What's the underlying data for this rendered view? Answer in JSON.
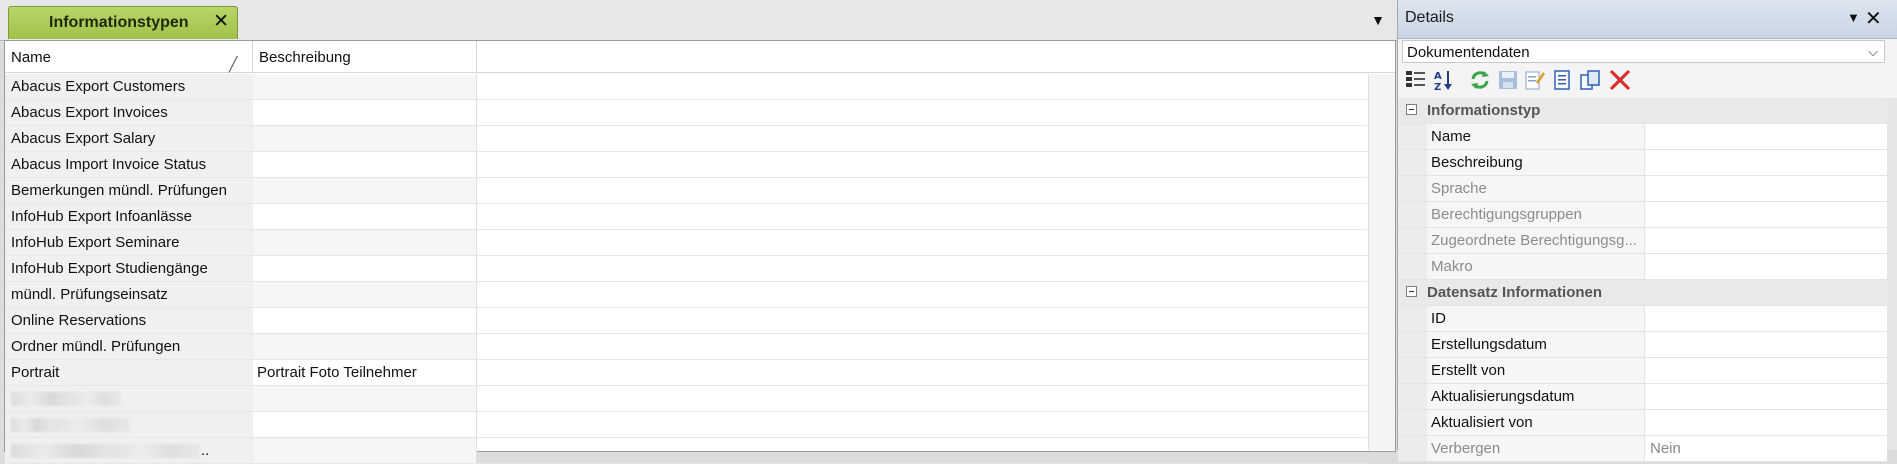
{
  "document": {
    "tab_label": "Informationstypen",
    "tab_close": "✕",
    "tab_dropdown": "▼"
  },
  "grid": {
    "columns": [
      "Name",
      "Beschreibung"
    ],
    "rows": [
      {
        "name": "Abacus Export Customers",
        "desc": ""
      },
      {
        "name": "Abacus Export Invoices",
        "desc": ""
      },
      {
        "name": "Abacus Export Salary",
        "desc": ""
      },
      {
        "name": "Abacus Import Invoice Status",
        "desc": ""
      },
      {
        "name": "Bemerkungen mündl. Prüfungen",
        "desc": ""
      },
      {
        "name": "InfoHub Export Infoanlässe",
        "desc": ""
      },
      {
        "name": "InfoHub Export Seminare",
        "desc": ""
      },
      {
        "name": "InfoHub Export Studiengänge",
        "desc": ""
      },
      {
        "name": "mündl. Prüfungseinsatz",
        "desc": ""
      },
      {
        "name": "Online Reservations",
        "desc": ""
      },
      {
        "name": "Ordner mündl. Prüfungen",
        "desc": ""
      },
      {
        "name": "Portrait",
        "desc": "Portrait Foto Teilnehmer"
      },
      {
        "name": "",
        "desc": ""
      },
      {
        "name": "",
        "desc": ""
      },
      {
        "name": "..",
        "desc": ""
      }
    ]
  },
  "details": {
    "title": "Details",
    "menu_glyph": "▼",
    "close_glyph": "✕",
    "selector_value": "Dokumentendaten",
    "selector_arrow": "⌵",
    "toolbar_icons": [
      "categorized-icon",
      "sort-az-icon",
      "refresh-icon",
      "save-icon",
      "edit-icon",
      "document-icon",
      "copy-icon",
      "delete-icon"
    ],
    "categories": [
      {
        "name": "Informationstyp",
        "props": [
          {
            "name": "Name",
            "value": "",
            "readonly": false
          },
          {
            "name": "Beschreibung",
            "value": "",
            "readonly": false
          },
          {
            "name": "Sprache",
            "value": "",
            "readonly": true
          },
          {
            "name": "Berechtigungsgruppen",
            "value": "",
            "readonly": true
          },
          {
            "name": "Zugeordnete Berechtigungsg...",
            "value": "",
            "readonly": true
          },
          {
            "name": "Makro",
            "value": "",
            "readonly": true
          }
        ]
      },
      {
        "name": "Datensatz Informationen",
        "props": [
          {
            "name": "ID",
            "value": "",
            "readonly": false
          },
          {
            "name": "Erstellungsdatum",
            "value": "",
            "readonly": false
          },
          {
            "name": "Erstellt von",
            "value": "",
            "readonly": false
          },
          {
            "name": "Aktualisierungsdatum",
            "value": "",
            "readonly": false
          },
          {
            "name": "Aktualisiert von",
            "value": "",
            "readonly": false
          },
          {
            "name": "Verbergen",
            "value": "Nein",
            "readonly": true
          }
        ]
      }
    ]
  },
  "colors": {
    "tab_green": "#9fc24a",
    "panel_title": "#c8d4e3",
    "delete_red": "#d83030"
  }
}
